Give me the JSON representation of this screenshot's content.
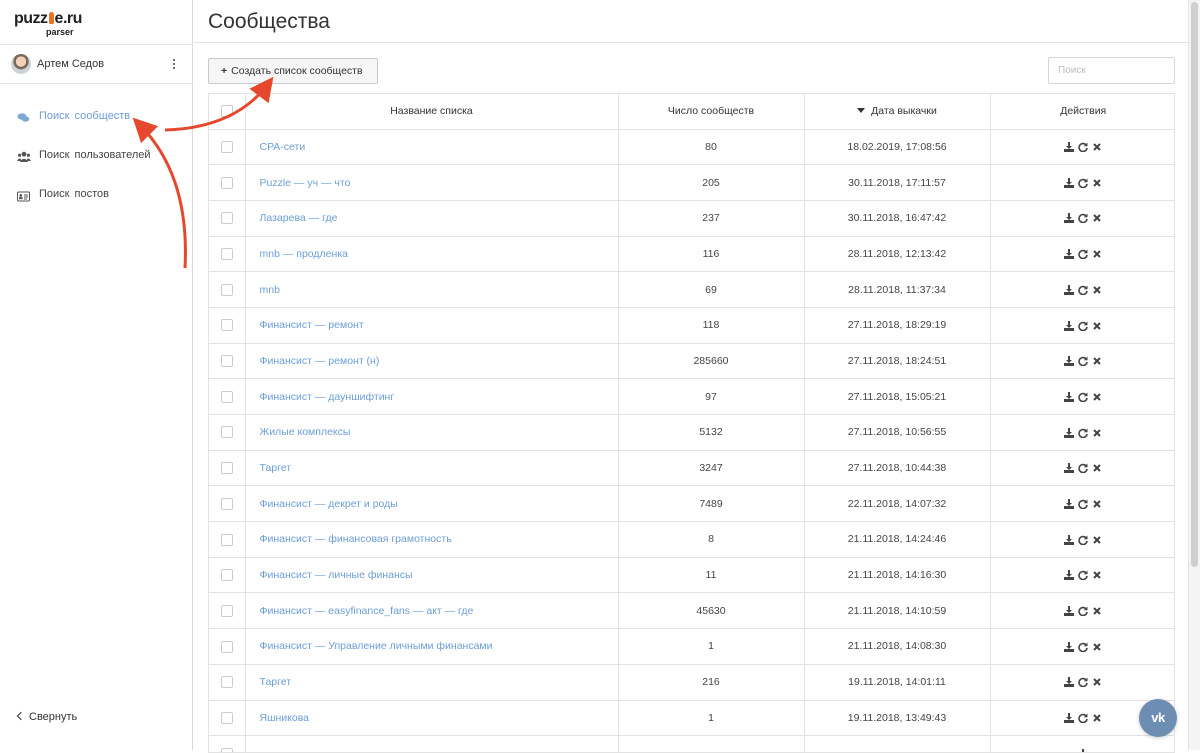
{
  "logo": {
    "brand_left": "puzz",
    "brand_right": "e.ru",
    "sub": "parser"
  },
  "user": {
    "name": "Артем Седов"
  },
  "nav": [
    {
      "label": "Поиск сообществ",
      "icon": "comments-icon",
      "active": true
    },
    {
      "label": "Поиск пользователей",
      "icon": "users-icon",
      "active": false
    },
    {
      "label": "Поиск постов",
      "icon": "id-card-icon",
      "active": false
    }
  ],
  "collapse_label": "Свернуть",
  "page_title": "Сообщества",
  "toolbar": {
    "create_label": "Создать список сообществ",
    "search_placeholder": "Поиск"
  },
  "table": {
    "headers": {
      "name": "Название списка",
      "count": "Число сообществ",
      "date": "Дата выкачки",
      "actions": "Действия"
    },
    "rows": [
      {
        "name": "CPA-сети",
        "count": "80",
        "date": "18.02.2019, 17:08:56"
      },
      {
        "name": "Puzzle — уч — что",
        "count": "205",
        "date": "30.11.2018, 17:11:57"
      },
      {
        "name": "Лазарева — где",
        "count": "237",
        "date": "30.11.2018, 16:47:42"
      },
      {
        "name": "mnb — продленка",
        "count": "116",
        "date": "28.11.2018, 12:13:42"
      },
      {
        "name": "mnb",
        "count": "69",
        "date": "28.11.2018, 11:37:34"
      },
      {
        "name": "Финансист — ремонт",
        "count": "118",
        "date": "27.11.2018, 18:29:19"
      },
      {
        "name": "Финансист — ремонт (н)",
        "count": "285660",
        "date": "27.11.2018, 18:24:51"
      },
      {
        "name": "Финансист — дауншифтинг",
        "count": "97",
        "date": "27.11.2018, 15:05:21"
      },
      {
        "name": "Жилые комплексы",
        "count": "5132",
        "date": "27.11.2018, 10:56:55"
      },
      {
        "name": "Таргет",
        "count": "3247",
        "date": "27.11.2018, 10:44:38"
      },
      {
        "name": "Финансист — декрет и роды",
        "count": "7489",
        "date": "22.11.2018, 14:07:32"
      },
      {
        "name": "Финансист — финансовая грамотность",
        "count": "8",
        "date": "21.11.2018, 14:24:46"
      },
      {
        "name": "Финансист — личные финансы",
        "count": "11",
        "date": "21.11.2018, 14:16:30"
      },
      {
        "name": "Финансист — easyfinance_fans — акт — где",
        "count": "45630",
        "date": "21.11.2018, 14:10:59"
      },
      {
        "name": "Финансист — Управление личными финансами",
        "count": "1",
        "date": "21.11.2018, 14:08:30"
      },
      {
        "name": "Таргет",
        "count": "216",
        "date": "19.11.2018, 14:01:11"
      },
      {
        "name": "Яшникова",
        "count": "1",
        "date": "19.11.2018, 13:49:43"
      },
      {
        "name": "",
        "count": "",
        "date": ""
      }
    ]
  },
  "vk_label": "vk",
  "colors": {
    "link": "#6d9ed6",
    "arrow": "#e5482d",
    "vk": "#6d8db3",
    "carrot": "#e8742a"
  }
}
